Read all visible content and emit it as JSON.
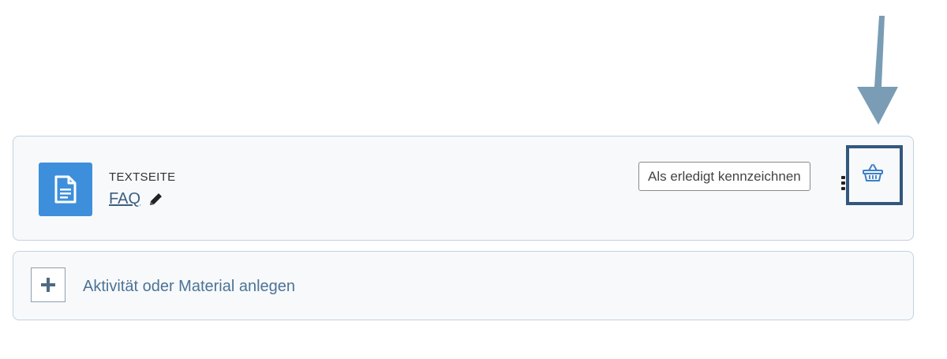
{
  "activity": {
    "type_label": "TEXTSEITE",
    "name": "FAQ",
    "icon": "document-icon",
    "icon_color": "#3d8fdc"
  },
  "actions": {
    "mark_done_label": "Als erledigt kennzeichnen",
    "menu_icon": "vertical-dots-icon",
    "basket_icon": "basket-icon"
  },
  "add": {
    "label": "Aktivität oder Material anlegen",
    "icon": "plus-icon"
  },
  "annotation": {
    "arrow_color": "#7a9db5",
    "highlight_color": "#33577e"
  }
}
